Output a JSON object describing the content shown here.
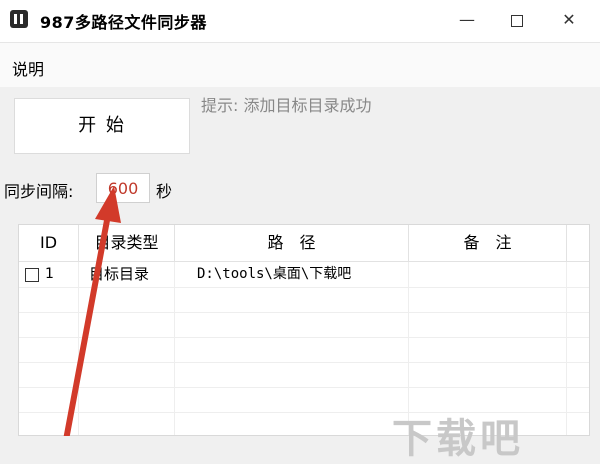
{
  "window": {
    "title": "987多路径文件同步器",
    "min_glyph": "—",
    "close_glyph": "✕"
  },
  "menu": {
    "items": [
      {
        "label": "说明"
      }
    ]
  },
  "main": {
    "start_label": "开 始",
    "hint": "提示: 添加目标目录成功",
    "interval_label": "同步间隔:",
    "interval_value": "600",
    "interval_unit": "秒"
  },
  "table": {
    "columns": [
      "ID",
      "目录类型",
      "路　径",
      "备　注"
    ],
    "rows": [
      {
        "id": "1",
        "type": "目标目录",
        "path": "D:\\tools\\桌面\\下载吧",
        "note": "",
        "checked": false
      }
    ],
    "empty_rows": 6
  },
  "annotation_color": "#d23a2a",
  "watermark": "下载吧"
}
